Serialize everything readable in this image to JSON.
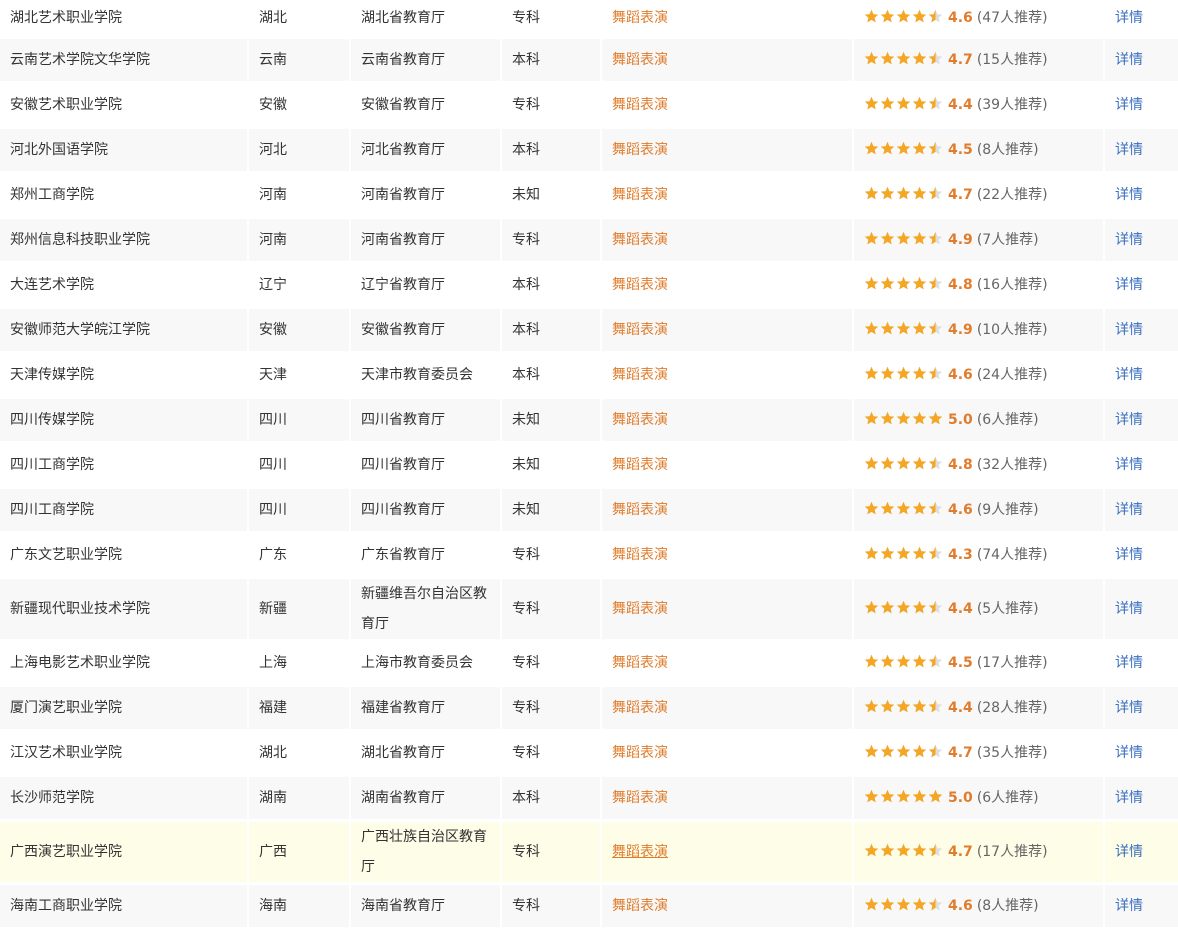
{
  "colors": {
    "accent_orange": "#e07c2b",
    "star": "#f5a623",
    "link_blue": "#3a6fbf",
    "row_highlight": "#fdfde8"
  },
  "rows": [
    {
      "name": "湖北艺术职业学院",
      "province": "湖北",
      "dept": "湖北省教育厅",
      "level": "专科",
      "major": "舞蹈表演",
      "score": "4.6",
      "count": "(47人推荐)",
      "detail": "详情",
      "rating": 4.6
    },
    {
      "name": "云南艺术学院文华学院",
      "province": "云南",
      "dept": "云南省教育厅",
      "level": "本科",
      "major": "舞蹈表演",
      "score": "4.7",
      "count": "(15人推荐)",
      "detail": "详情",
      "rating": 4.7
    },
    {
      "name": "安徽艺术职业学院",
      "province": "安徽",
      "dept": "安徽省教育厅",
      "level": "专科",
      "major": "舞蹈表演",
      "score": "4.4",
      "count": "(39人推荐)",
      "detail": "详情",
      "rating": 4.4
    },
    {
      "name": "河北外国语学院",
      "province": "河北",
      "dept": "河北省教育厅",
      "level": "本科",
      "major": "舞蹈表演",
      "score": "4.5",
      "count": "(8人推荐)",
      "detail": "详情",
      "rating": 4.5
    },
    {
      "name": "郑州工商学院",
      "province": "河南",
      "dept": "河南省教育厅",
      "level": "未知",
      "major": "舞蹈表演",
      "score": "4.7",
      "count": "(22人推荐)",
      "detail": "详情",
      "rating": 4.7
    },
    {
      "name": "郑州信息科技职业学院",
      "province": "河南",
      "dept": "河南省教育厅",
      "level": "专科",
      "major": "舞蹈表演",
      "score": "4.9",
      "count": "(7人推荐)",
      "detail": "详情",
      "rating": 4.9
    },
    {
      "name": "大连艺术学院",
      "province": "辽宁",
      "dept": "辽宁省教育厅",
      "level": "本科",
      "major": "舞蹈表演",
      "score": "4.8",
      "count": "(16人推荐)",
      "detail": "详情",
      "rating": 4.8
    },
    {
      "name": "安徽师范大学皖江学院",
      "province": "安徽",
      "dept": "安徽省教育厅",
      "level": "本科",
      "major": "舞蹈表演",
      "score": "4.9",
      "count": "(10人推荐)",
      "detail": "详情",
      "rating": 4.9
    },
    {
      "name": "天津传媒学院",
      "province": "天津",
      "dept": "天津市教育委员会",
      "level": "本科",
      "major": "舞蹈表演",
      "score": "4.6",
      "count": "(24人推荐)",
      "detail": "详情",
      "rating": 4.6
    },
    {
      "name": "四川传媒学院",
      "province": "四川",
      "dept": "四川省教育厅",
      "level": "未知",
      "major": "舞蹈表演",
      "score": "5.0",
      "count": "(6人推荐)",
      "detail": "详情",
      "rating": 5.0
    },
    {
      "name": "四川工商学院",
      "province": "四川",
      "dept": "四川省教育厅",
      "level": "未知",
      "major": "舞蹈表演",
      "score": "4.8",
      "count": "(32人推荐)",
      "detail": "详情",
      "rating": 4.8
    },
    {
      "name": "四川工商学院",
      "province": "四川",
      "dept": "四川省教育厅",
      "level": "未知",
      "major": "舞蹈表演",
      "score": "4.6",
      "count": "(9人推荐)",
      "detail": "详情",
      "rating": 4.6
    },
    {
      "name": "广东文艺职业学院",
      "province": "广东",
      "dept": "广东省教育厅",
      "level": "专科",
      "major": "舞蹈表演",
      "score": "4.3",
      "count": "(74人推荐)",
      "detail": "详情",
      "rating": 4.3
    },
    {
      "name": "新疆现代职业技术学院",
      "province": "新疆",
      "dept": "新疆维吾尔自治区教育厅",
      "level": "专科",
      "major": "舞蹈表演",
      "score": "4.4",
      "count": "(5人推荐)",
      "detail": "详情",
      "rating": 4.4,
      "tall": true
    },
    {
      "name": "上海电影艺术职业学院",
      "province": "上海",
      "dept": "上海市教育委员会",
      "level": "专科",
      "major": "舞蹈表演",
      "score": "4.5",
      "count": "(17人推荐)",
      "detail": "详情",
      "rating": 4.5
    },
    {
      "name": "厦门演艺职业学院",
      "province": "福建",
      "dept": "福建省教育厅",
      "level": "专科",
      "major": "舞蹈表演",
      "score": "4.4",
      "count": "(28人推荐)",
      "detail": "详情",
      "rating": 4.4
    },
    {
      "name": "江汉艺术职业学院",
      "province": "湖北",
      "dept": "湖北省教育厅",
      "level": "专科",
      "major": "舞蹈表演",
      "score": "4.7",
      "count": "(35人推荐)",
      "detail": "详情",
      "rating": 4.7
    },
    {
      "name": "长沙师范学院",
      "province": "湖南",
      "dept": "湖南省教育厅",
      "level": "本科",
      "major": "舞蹈表演",
      "score": "5.0",
      "count": "(6人推荐)",
      "detail": "详情",
      "rating": 5.0
    },
    {
      "name": "广西演艺职业学院",
      "province": "广西",
      "dept": "广西壮族自治区教育厅",
      "level": "专科",
      "major": "舞蹈表演",
      "score": "4.7",
      "count": "(17人推荐)",
      "detail": "详情",
      "rating": 4.7,
      "tall": true,
      "highlight": true
    },
    {
      "name": "海南工商职业学院",
      "province": "海南",
      "dept": "海南省教育厅",
      "level": "专科",
      "major": "舞蹈表演",
      "score": "4.6",
      "count": "(8人推荐)",
      "detail": "详情",
      "rating": 4.6
    }
  ]
}
